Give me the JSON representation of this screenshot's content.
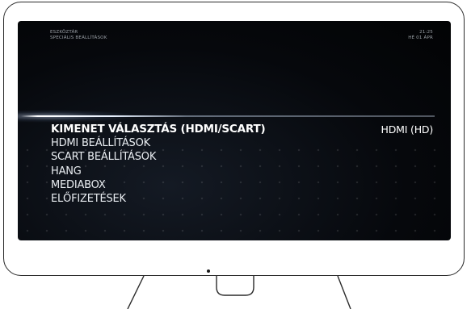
{
  "header": {
    "section": "ESZKÖZTÁR",
    "subsection": "SPECIÁLIS BEÁLLÍTÁSOK",
    "time": "21:25",
    "date": "HÉ 01 ÁPR"
  },
  "menu": {
    "items": [
      {
        "label": "KIMENET VÁLASZTÁS (HDMI/SCART)",
        "selected": true
      },
      {
        "label": "HDMI BEÁLLÍTÁSOK",
        "selected": false
      },
      {
        "label": "SCART BEÁLLÍTÁSOK",
        "selected": false
      },
      {
        "label": "HANG",
        "selected": false
      },
      {
        "label": "MEDIABOX",
        "selected": false
      },
      {
        "label": "ELŐFIZETÉSEK",
        "selected": false
      }
    ],
    "selected_value": "HDMI (HD)"
  },
  "colors": {
    "screen_background": "#05070a",
    "text": "#e9edf1",
    "header_text": "#9aa0a6",
    "highlight_line": "#ffffff",
    "frame": "#2a2a2a"
  }
}
